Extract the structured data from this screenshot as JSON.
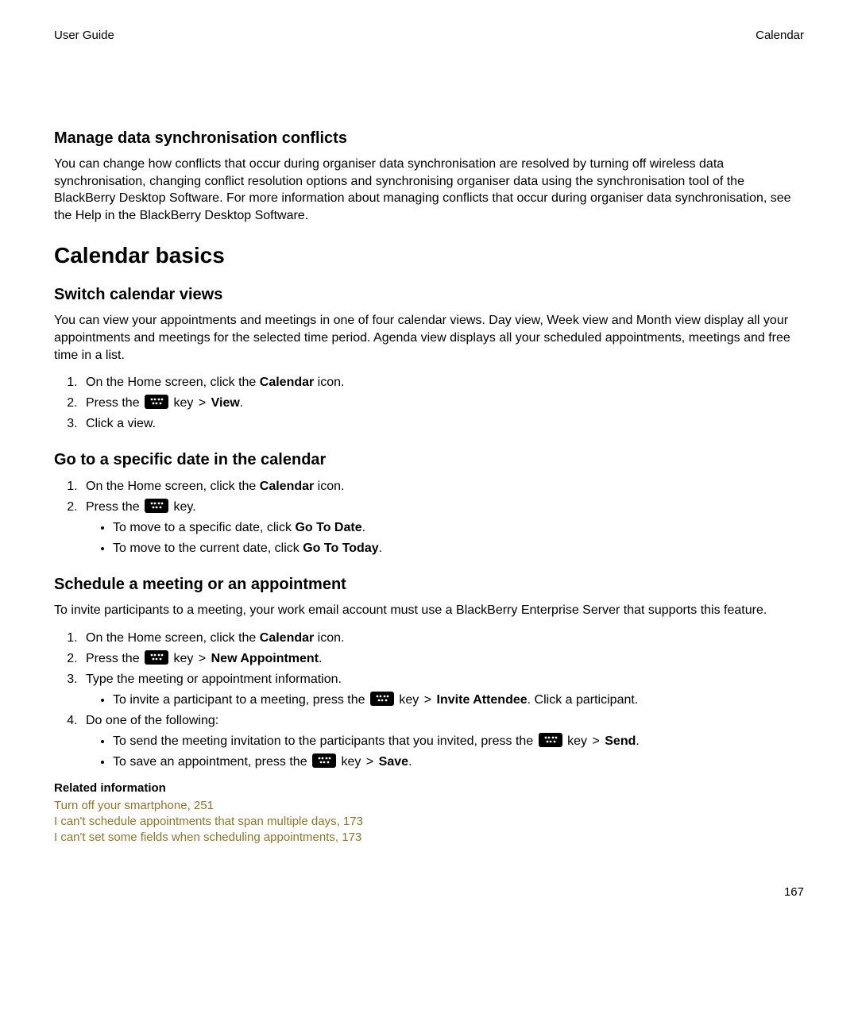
{
  "header": {
    "left": "User Guide",
    "right": "Calendar"
  },
  "sections": {
    "conflicts": {
      "title": "Manage data synchronisation conflicts",
      "body": "You can change how conflicts that occur during organiser data synchronisation are resolved by turning off wireless data synchronisation, changing conflict resolution options and synchronising organiser data using the synchronisation tool of the BlackBerry Desktop Software. For more information about managing conflicts that occur during organiser data synchronisation, see the Help in the BlackBerry Desktop Software."
    },
    "basics": {
      "title": "Calendar basics"
    },
    "switchViews": {
      "title": "Switch calendar views",
      "body": "You can view your appointments and meetings in one of four calendar views. Day view, Week view and Month view display all your appointments and meetings for the selected time period. Agenda view displays all your scheduled appointments, meetings and free time in a list.",
      "step1_pre": "On the Home screen, click the ",
      "step1_bold": "Calendar",
      "step1_post": " icon.",
      "step2_pre": "Press the ",
      "step2_post1": " key ",
      "step2_gt": ">",
      "step2_view": "View",
      "step2_dot": ".",
      "step3": "Click a view."
    },
    "gotoDate": {
      "title": "Go to a specific date in the calendar",
      "step1_pre": "On the Home screen, click the ",
      "step1_bold": "Calendar",
      "step1_post": " icon.",
      "step2_pre": "Press the ",
      "step2_post": " key.",
      "bullet1_pre": "To move to a specific date, click ",
      "bullet1_bold": "Go To Date",
      "bullet1_post": ".",
      "bullet2_pre": "To move to the current date, click ",
      "bullet2_bold": "Go To Today",
      "bullet2_post": "."
    },
    "schedule": {
      "title": "Schedule a meeting or an appointment",
      "body": "To invite participants to a meeting, your work email account must use a BlackBerry Enterprise Server that supports this feature.",
      "step1_pre": "On the Home screen, click the ",
      "step1_bold": "Calendar",
      "step1_post": " icon.",
      "step2_pre": "Press the ",
      "step2_mid": " key ",
      "step2_gt": ">",
      "step2_bold": "New Appointment",
      "step2_post": ".",
      "step3": "Type the meeting or appointment information.",
      "step3b_pre": "To invite a participant to a meeting, press the ",
      "step3b_mid": " key ",
      "step3b_gt": ">",
      "step3b_bold": "Invite Attendee",
      "step3b_post": ". Click a participant.",
      "step4": "Do one of the following:",
      "step4a_pre": "To send the meeting invitation to the participants that you invited, press the ",
      "step4a_mid": " key ",
      "step4a_gt": ">",
      "step4a_bold": "Send",
      "step4a_post": ".",
      "step4b_pre": "To save an appointment, press the ",
      "step4b_mid": " key ",
      "step4b_gt": ">",
      "step4b_bold": "Save",
      "step4b_post": "."
    },
    "related": {
      "title": "Related information",
      "links": [
        "Turn off your smartphone, 251",
        "I can't schedule appointments that span multiple days, 173",
        "I can't set some fields when scheduling appointments, 173"
      ]
    }
  },
  "pageNum": "167"
}
